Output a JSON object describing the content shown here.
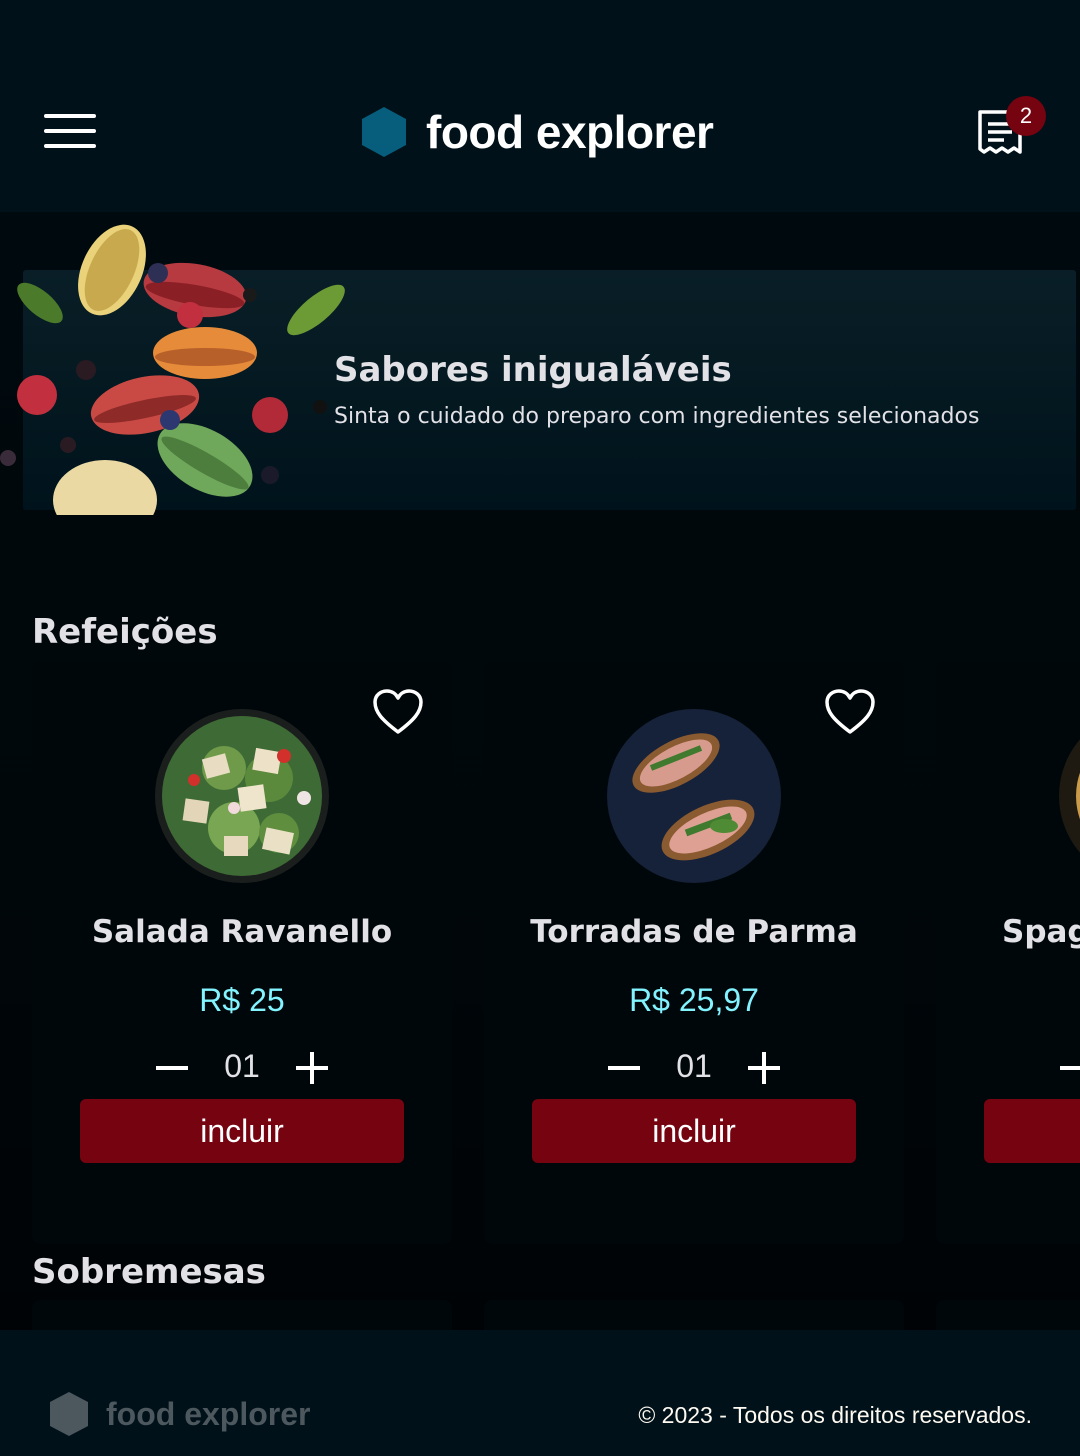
{
  "header": {
    "brand": "food explorer",
    "cart_count": "2"
  },
  "banner": {
    "title": "Sabores inigualáveis",
    "subtitle": "Sinta o cuidado do preparo com ingredientes selecionados"
  },
  "sections": {
    "meals": "Refeições",
    "desserts": "Sobremesas"
  },
  "meals": [
    {
      "name": "Salada Ravanello",
      "price": "R$ 25",
      "qty": "01",
      "button": "incluir"
    },
    {
      "name": "Torradas de Parma",
      "price": "R$ 25,97",
      "qty": "01",
      "button": "incluir"
    },
    {
      "name": "Spag",
      "button": ""
    }
  ],
  "footer": {
    "brand": "food explorer",
    "copyright": "© 2023 - Todos os direitos reservados."
  },
  "colors": {
    "header_bg": "#00111A",
    "accent_red": "#750310",
    "price_cyan": "#82F3FF",
    "brand_hex": "#065E7C"
  }
}
